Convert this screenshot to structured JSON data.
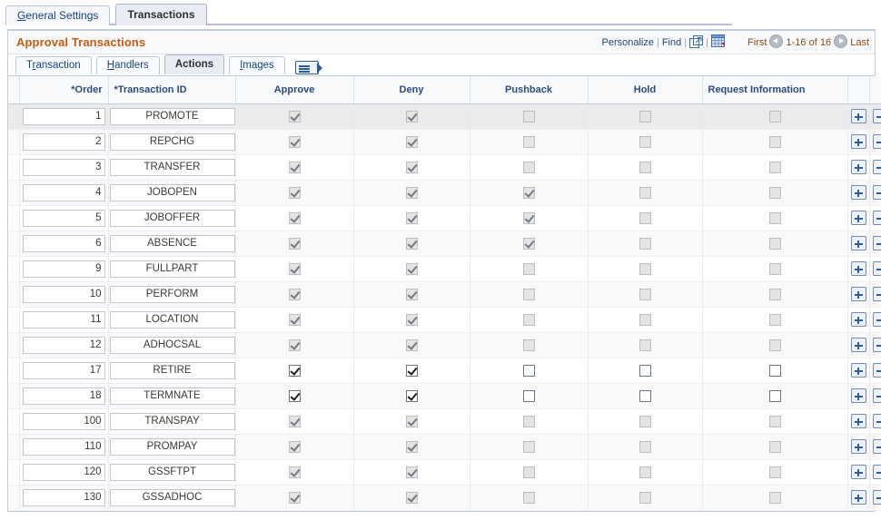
{
  "top_tabs": [
    {
      "label": "General Settings",
      "accel": "G",
      "active": false
    },
    {
      "label": "Transactions",
      "accel": "",
      "active": true
    }
  ],
  "group_box": {
    "title": "Approval Transactions",
    "toolbar": {
      "personalize": "Personalize",
      "find": "Find",
      "sep": "|",
      "new_window_icon": "new-window-icon",
      "download_xls_icon": "download-to-excel-icon"
    },
    "pager": {
      "first": "First",
      "range": "1-16 of 16",
      "last": "Last",
      "prev_icon": "previous-arrow-icon",
      "next_icon": "next-arrow-icon"
    }
  },
  "sub_tabs": [
    {
      "label": "Transaction",
      "accel": "r",
      "active": false
    },
    {
      "label": "Handlers",
      "accel": "H",
      "active": false
    },
    {
      "label": "Actions",
      "accel": "",
      "active": true
    },
    {
      "label": "Images",
      "accel": "I",
      "active": false
    }
  ],
  "sub_tabs_icon": "show-next-tabs-icon",
  "grid": {
    "columns": [
      {
        "key": "order",
        "label": "*Order",
        "align": "r"
      },
      {
        "key": "txn_id",
        "label": "*Transaction ID",
        "align": "l"
      },
      {
        "key": "approve",
        "label": "Approve",
        "align": "c"
      },
      {
        "key": "deny",
        "label": "Deny",
        "align": "c"
      },
      {
        "key": "pushback",
        "label": "Pushback",
        "align": "c"
      },
      {
        "key": "hold",
        "label": "Hold",
        "align": "c"
      },
      {
        "key": "request_info",
        "label": "Request Information",
        "align": "l"
      }
    ],
    "add_row_label": "+",
    "delete_row_label": "-",
    "rows": [
      {
        "order": "1",
        "txn_id": "PROMOTE",
        "approve": true,
        "deny": true,
        "pushback": false,
        "hold": false,
        "request_info": false,
        "enabled": false
      },
      {
        "order": "2",
        "txn_id": "REPCHG",
        "approve": true,
        "deny": true,
        "pushback": false,
        "hold": false,
        "request_info": false,
        "enabled": false
      },
      {
        "order": "3",
        "txn_id": "TRANSFER",
        "approve": true,
        "deny": true,
        "pushback": false,
        "hold": false,
        "request_info": false,
        "enabled": false
      },
      {
        "order": "4",
        "txn_id": "JOBOPEN",
        "approve": true,
        "deny": true,
        "pushback": true,
        "hold": false,
        "request_info": false,
        "enabled": false
      },
      {
        "order": "5",
        "txn_id": "JOBOFFER",
        "approve": true,
        "deny": true,
        "pushback": true,
        "hold": false,
        "request_info": false,
        "enabled": false
      },
      {
        "order": "6",
        "txn_id": "ABSENCE",
        "approve": true,
        "deny": true,
        "pushback": true,
        "hold": false,
        "request_info": false,
        "enabled": false
      },
      {
        "order": "9",
        "txn_id": "FULLPART",
        "approve": true,
        "deny": true,
        "pushback": false,
        "hold": false,
        "request_info": false,
        "enabled": false
      },
      {
        "order": "10",
        "txn_id": "PERFORM",
        "approve": true,
        "deny": true,
        "pushback": false,
        "hold": false,
        "request_info": false,
        "enabled": false
      },
      {
        "order": "11",
        "txn_id": "LOCATION",
        "approve": true,
        "deny": true,
        "pushback": false,
        "hold": false,
        "request_info": false,
        "enabled": false
      },
      {
        "order": "12",
        "txn_id": "ADHOCSAL",
        "approve": true,
        "deny": true,
        "pushback": false,
        "hold": false,
        "request_info": false,
        "enabled": false
      },
      {
        "order": "17",
        "txn_id": "RETIRE",
        "approve": true,
        "deny": true,
        "pushback": false,
        "hold": false,
        "request_info": false,
        "enabled": true
      },
      {
        "order": "18",
        "txn_id": "TERMNATE",
        "approve": true,
        "deny": true,
        "pushback": false,
        "hold": false,
        "request_info": false,
        "enabled": true
      },
      {
        "order": "100",
        "txn_id": "TRANSPAY",
        "approve": true,
        "deny": true,
        "pushback": false,
        "hold": false,
        "request_info": false,
        "enabled": false
      },
      {
        "order": "110",
        "txn_id": "PROMPAY",
        "approve": true,
        "deny": true,
        "pushback": false,
        "hold": false,
        "request_info": false,
        "enabled": false
      },
      {
        "order": "120",
        "txn_id": "GSSFTPT",
        "approve": true,
        "deny": true,
        "pushback": false,
        "hold": false,
        "request_info": false,
        "enabled": false
      },
      {
        "order": "130",
        "txn_id": "GSSADHOC",
        "approve": true,
        "deny": true,
        "pushback": false,
        "hold": false,
        "request_info": false,
        "enabled": false
      }
    ]
  },
  "colors": {
    "group_title": "#c75b12",
    "link": "#22457c",
    "tab_link": "#15428b",
    "header_text": "#2b4c82",
    "row_button": "#2f5e9e"
  }
}
